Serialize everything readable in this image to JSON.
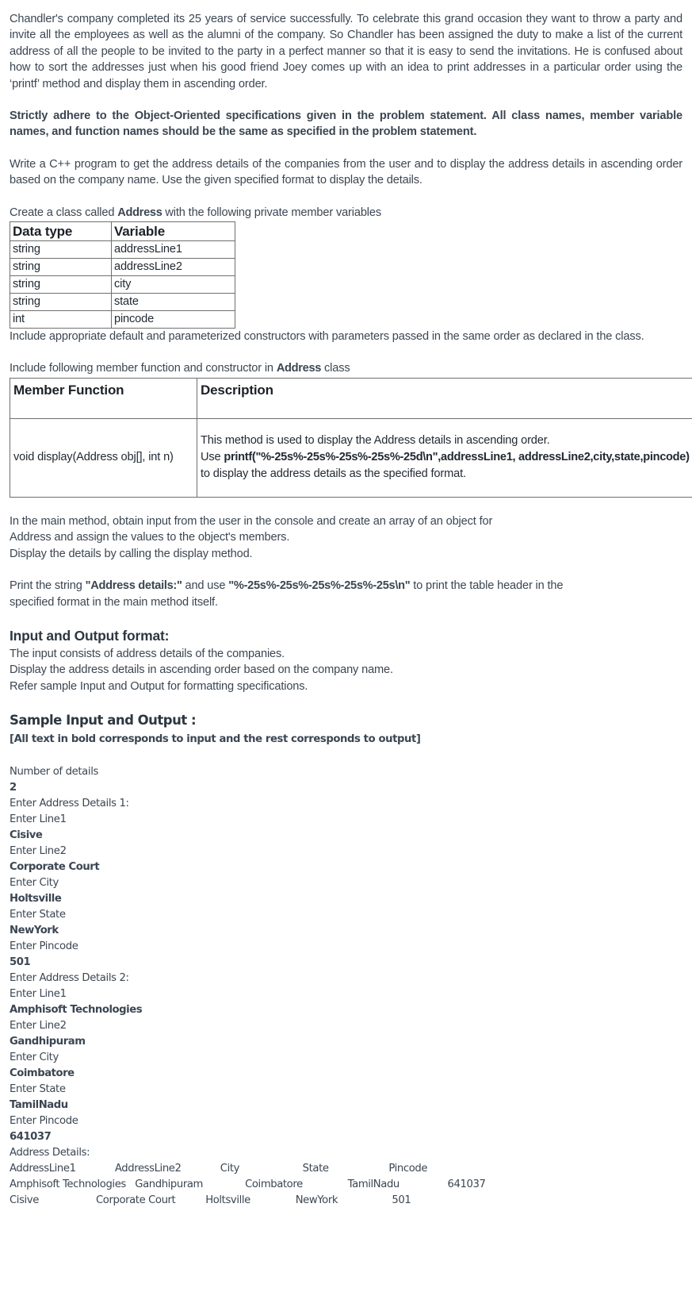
{
  "intro": {
    "paragraph": "Chandler's company completed its 25 years of service successfully. To celebrate this grand occasion they want to throw a party and invite all the employees as well as the alumni of the company. So Chandler has been assigned the duty to make a list of the current address of all the people to be invited to the party in a perfect manner so that it is easy to send the invitations. He is confused about how to sort the addresses just when his good friend Joey comes up with an idea to print addresses in a particular order using the ‘printf’ method and display them in ascending order.",
    "strict_note": "Strictly adhere to the Object-Oriented specifications given in the problem statement. All class names, member variable names, and function names should be the same as specified in the problem statement.",
    "task": "Write a C++ program to get the address details of the companies from the user and to display the address details in ascending order based on the company name. Use the given specified format to display the details."
  },
  "class_table": {
    "caption_pre": "Create a class called ",
    "caption_class": "Address",
    "caption_post": " with the following private member variables",
    "headers": [
      "Data type",
      "Variable"
    ],
    "rows": [
      [
        "string",
        "addressLine1"
      ],
      [
        "string",
        "addressLine2"
      ],
      [
        "string",
        "city"
      ],
      [
        "string",
        "state"
      ],
      [
        "int",
        "pincode"
      ]
    ],
    "footer_note": "Include appropriate default and parameterized constructors with parameters passed in the same order as declared in the class."
  },
  "member_table": {
    "caption_pre": "Include following member function and constructor in ",
    "caption_class": "Address",
    "caption_post": " class",
    "headers": [
      "Member Function",
      "Description"
    ],
    "row": {
      "signature": "void display(Address obj[], int n)",
      "desc_line1": "This method is used to display the Address details in ascending order.",
      "desc_line2_pre": "Use ",
      "desc_line2_code": "printf(\"%-25s%-25s%-25s%-25s%-25d\\n\",addressLine1, addressLine2,city,state,pincode)",
      "desc_line3": "to display the address details as the specified format."
    }
  },
  "main_method": {
    "line1": "In the main method, obtain input from the user in the console and create an array of an object for",
    "line2": "Address and assign the values to the object's members.",
    "line3": "Display the details by calling the display method.",
    "print_pre": "Print the string ",
    "print_str1": "\"Address details:\"",
    "print_mid": " and use ",
    "print_str2": "\"%-25s%-25s%-25s%-25s%-25s\\n\"",
    "print_post": " to print the table header in the",
    "print_line2": "specified format in the main method itself."
  },
  "io_format": {
    "heading": "Input and Output format:",
    "lines": [
      "The input consists of address details of the companies.",
      "Display the address details in ascending order based on the company name.",
      "Refer sample Input and Output for formatting specifications."
    ]
  },
  "sample": {
    "heading": "Sample Input and Output :",
    "note": "[All text in bold corresponds to input and the rest corresponds to output]",
    "transcript": [
      {
        "text": "Number of details",
        "input": false
      },
      {
        "text": "2",
        "input": true
      },
      {
        "text": "Enter Address Details 1:",
        "input": false
      },
      {
        "text": "Enter Line1",
        "input": false
      },
      {
        "text": "Cisive",
        "input": true
      },
      {
        "text": "Enter Line2",
        "input": false
      },
      {
        "text": "Corporate Court",
        "input": true
      },
      {
        "text": "Enter City",
        "input": false
      },
      {
        "text": "Holtsville",
        "input": true
      },
      {
        "text": "Enter State",
        "input": false
      },
      {
        "text": "NewYork",
        "input": true
      },
      {
        "text": "Enter Pincode",
        "input": false
      },
      {
        "text": "501",
        "input": true
      },
      {
        "text": "Enter Address Details 2:",
        "input": false
      },
      {
        "text": "Enter Line1",
        "input": false
      },
      {
        "text": "Amphisoft Technologies",
        "input": true
      },
      {
        "text": "Enter Line2",
        "input": false
      },
      {
        "text": "Gandhipuram",
        "input": true
      },
      {
        "text": "Enter City",
        "input": false
      },
      {
        "text": "Coimbatore",
        "input": true
      },
      {
        "text": "Enter State",
        "input": false
      },
      {
        "text": "TamilNadu",
        "input": true
      },
      {
        "text": "Enter Pincode",
        "input": false
      },
      {
        "text": "641037",
        "input": true
      }
    ],
    "output_label": "Address Details:",
    "output_table": {
      "headers": [
        "AddressLine1",
        "AddressLine2",
        "City",
        "State",
        "Pincode"
      ],
      "rows": [
        [
          "Amphisoft Technologies",
          "Gandhipuram",
          "Coimbatore",
          "TamilNadu",
          "641037"
        ],
        [
          "Cisive",
          "Corporate Court",
          "Holtsville",
          "NewYork",
          "501"
        ]
      ],
      "field_width": 25
    }
  },
  "colors": {
    "text": "#3b4652",
    "heading": "#2d3740",
    "table_border": "#6f6f6f",
    "background": "#ffffff"
  }
}
